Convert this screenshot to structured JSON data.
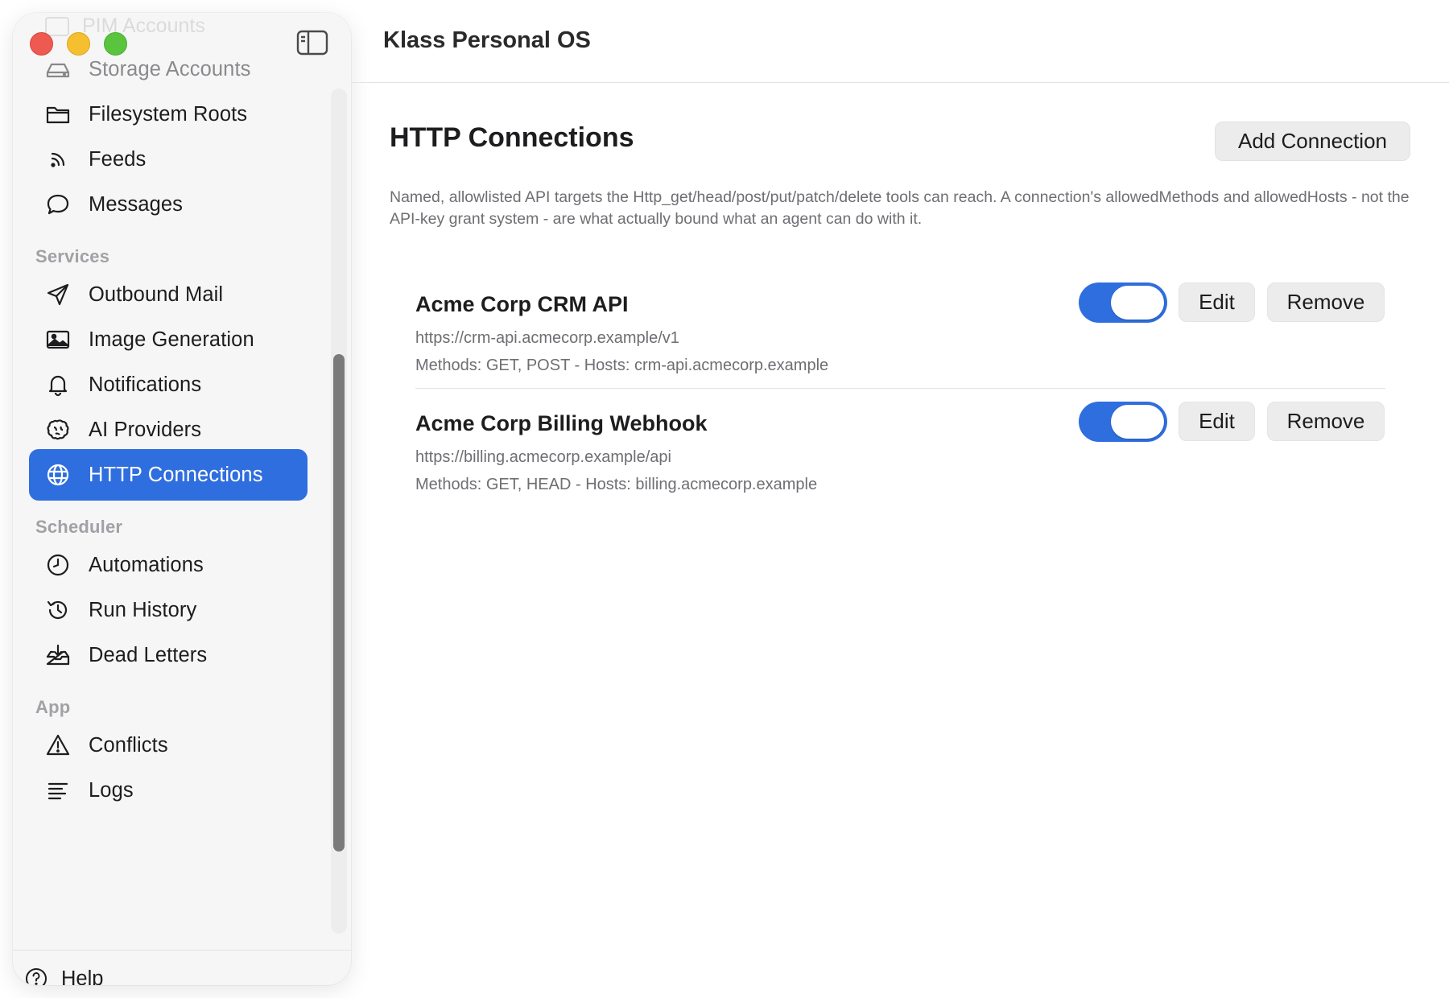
{
  "app": {
    "title": "Klass Personal OS"
  },
  "sidebar": {
    "ghost_item": "PIM Accounts",
    "top_items": [
      {
        "label": "Storage Accounts",
        "icon": "storage-icon"
      },
      {
        "label": "Filesystem Roots",
        "icon": "folder-icon"
      },
      {
        "label": "Feeds",
        "icon": "rss-icon"
      },
      {
        "label": "Messages",
        "icon": "chat-bubble-icon"
      }
    ],
    "sections": [
      {
        "header": "Services",
        "items": [
          {
            "label": "Outbound Mail",
            "icon": "paper-plane-icon"
          },
          {
            "label": "Image Generation",
            "icon": "image-icon"
          },
          {
            "label": "Notifications",
            "icon": "bell-icon"
          },
          {
            "label": "AI Providers",
            "icon": "brain-icon"
          },
          {
            "label": "HTTP Connections",
            "icon": "globe-icon",
            "active": true
          }
        ]
      },
      {
        "header": "Scheduler",
        "items": [
          {
            "label": "Automations",
            "icon": "clock-icon"
          },
          {
            "label": "Run History",
            "icon": "history-icon"
          },
          {
            "label": "Dead Letters",
            "icon": "inbox-tray-icon"
          }
        ]
      },
      {
        "header": "App",
        "items": [
          {
            "label": "Conflicts",
            "icon": "warning-triangle-icon"
          },
          {
            "label": "Logs",
            "icon": "lines-icon"
          }
        ]
      }
    ],
    "help_label": "Help"
  },
  "main": {
    "title": "HTTP Connections",
    "add_button": "Add Connection",
    "description": "Named, allowlisted API targets the Http_get/head/post/put/patch/delete tools can reach. A connection's allowedMethods and allowedHosts - not the API-key grant system - are what actually bound what an agent can do with it.",
    "connections": [
      {
        "name": "Acme Corp CRM API",
        "url": "https://crm-api.acmecorp.example/v1",
        "methods": "Methods: GET, POST",
        "hosts": "Hosts: crm-api.acmecorp.example",
        "enabled": true,
        "edit_label": "Edit",
        "remove_label": "Remove"
      },
      {
        "name": "Acme Corp Billing Webhook",
        "url": "https://billing.acmecorp.example/api",
        "methods": "Methods: GET, HEAD",
        "hosts": "Hosts: billing.acmecorp.example",
        "enabled": true,
        "edit_label": "Edit",
        "remove_label": "Remove"
      }
    ]
  },
  "colors": {
    "accent": "#2f6ede",
    "sidebar_bg": "#f6f6f6",
    "button_bg": "#ececec",
    "muted_text": "#6e6e73",
    "section_header": "#a1a1a6"
  }
}
